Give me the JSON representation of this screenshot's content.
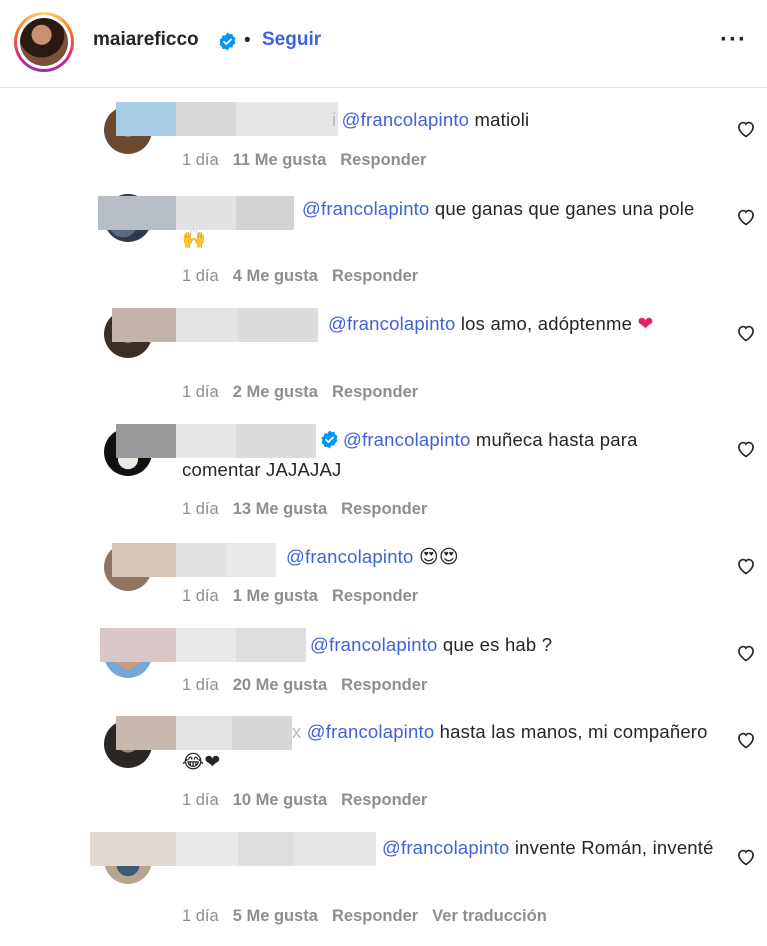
{
  "header": {
    "username": "maiareficco",
    "separator": "•",
    "follow_label": "Seguir",
    "more_label": "···"
  },
  "colors": {
    "mention": "#3f62d8",
    "verified": "#0095f6",
    "heart_like": "#e0245e"
  },
  "comments": [
    {
      "mention": "@francolapinto",
      "text": " matioli",
      "time": "1 día",
      "likes": "11 Me gusta",
      "reply": "Responder",
      "emojis": ""
    },
    {
      "mention": "@francolapinto",
      "text": " que ganas que ganes una pole ",
      "time": "1 día",
      "likes": "4 Me gusta",
      "reply": "Responder",
      "emojis": "🙌"
    },
    {
      "mention": "@francolapinto",
      "text": " los amo, adóptenme ",
      "time": "1 día",
      "likes": "2 Me gusta",
      "reply": "Responder",
      "emojis": "❤"
    },
    {
      "mention": "@francolapinto",
      "text": " muñeca hasta para comentar JAJAJAJ",
      "time": "1 día",
      "likes": "13 Me gusta",
      "reply": "Responder",
      "emojis": ""
    },
    {
      "mention": "@francolapinto",
      "text": " ",
      "time": "1 día",
      "likes": "1 Me gusta",
      "reply": "Responder",
      "emojis": "😍😍"
    },
    {
      "mention": "@francolapinto",
      "text": " que es hab ?",
      "time": "1 día",
      "likes": "20 Me gusta",
      "reply": "Responder",
      "emojis": ""
    },
    {
      "mention": "@francolapinto",
      "text": " hasta las manos, mi compañero ",
      "time": "1 día",
      "likes": "10 Me gusta",
      "reply": "Responder",
      "emojis": "😂❤"
    },
    {
      "mention": "@francolapinto",
      "text": " invente Román, inventé",
      "time": "1 día",
      "likes": "5 Me gusta",
      "reply": "Responder",
      "emojis": "",
      "translate": "Ver traducción"
    }
  ]
}
